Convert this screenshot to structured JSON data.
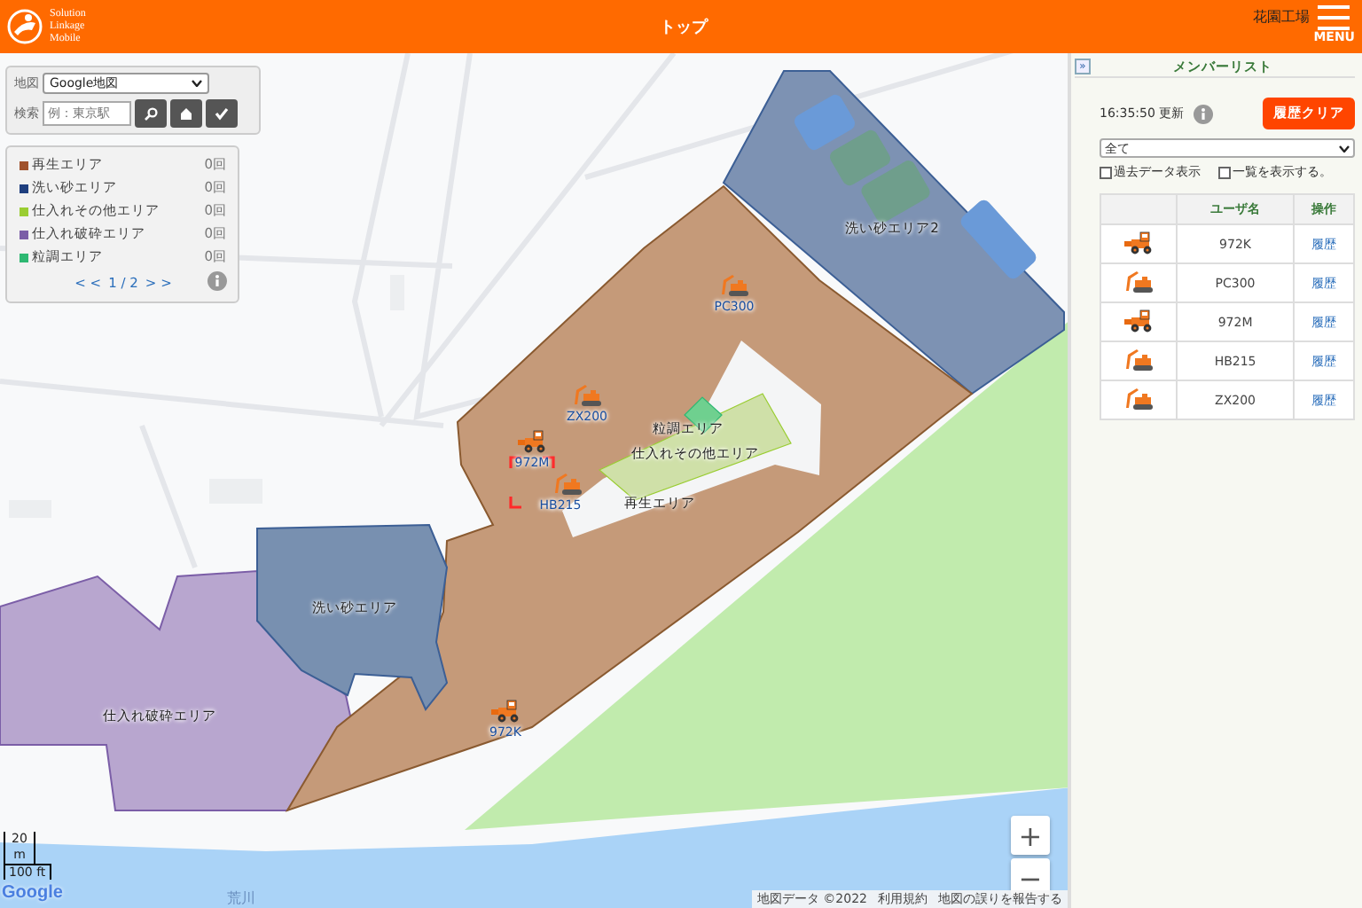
{
  "header": {
    "logo_lines": [
      "Solution",
      "Linkage",
      "Mobile"
    ],
    "title": "トップ",
    "site": "花園工場",
    "menu_label": "MENU"
  },
  "map_controls": {
    "map_label": "地図",
    "map_type": "Google地図",
    "search_label": "検索",
    "search_placeholder": "例：東京駅"
  },
  "legend": {
    "items": [
      {
        "name": "再生エリア",
        "count": "0回",
        "color": "#a0522d"
      },
      {
        "name": "洗い砂エリア",
        "count": "0回",
        "color": "#1f3f7f"
      },
      {
        "name": "仕入れその他エリア",
        "count": "0回",
        "color": "#9acd32"
      },
      {
        "name": "仕入れ破砕エリア",
        "count": "0回",
        "color": "#7b5ea7"
      },
      {
        "name": "粒調エリア",
        "count": "0回",
        "color": "#2eb872"
      }
    ],
    "pager_prev": "< <",
    "page": "1 / 2",
    "pager_next": "> >"
  },
  "map": {
    "areas": [
      {
        "label": "洗い砂エリア2"
      },
      {
        "label": "粒調エリア"
      },
      {
        "label": "仕入れその他エリア"
      },
      {
        "label": "再生エリア"
      },
      {
        "label": "洗い砂エリア"
      },
      {
        "label": "仕入れ破砕エリア"
      }
    ],
    "vehicles": [
      {
        "kind": "excavator",
        "label": "PC300",
        "selected": false
      },
      {
        "kind": "excavator",
        "label": "ZX200",
        "selected": false
      },
      {
        "kind": "loader",
        "label": "972M",
        "selected": true
      },
      {
        "kind": "excavator",
        "label": "HB215",
        "selected": false
      },
      {
        "kind": "loader",
        "label": "972K",
        "selected": false
      }
    ],
    "river_label": "荒川",
    "zoom_in": "+",
    "zoom_out": "−",
    "scale_metric": "20 m",
    "scale_imperial": "100 ft",
    "logo": "Google",
    "attribution": [
      "地図データ ©2022",
      "利用規約",
      "地図の誤りを報告する"
    ]
  },
  "member_list": {
    "collapse": "»",
    "title": "メンバーリスト",
    "updated": "16:35:50 更新",
    "clear_button": "履歴クリア",
    "filter": "全て",
    "options": [
      {
        "label": "過去データ表示",
        "checked": false
      },
      {
        "label": "一覧を表示する。",
        "checked": false
      }
    ],
    "columns": [
      "ユーザ名",
      "操作"
    ],
    "rows": [
      {
        "kind": "loader",
        "name": "972K",
        "action": "履歴"
      },
      {
        "kind": "excavator",
        "name": "PC300",
        "action": "履歴"
      },
      {
        "kind": "loader",
        "name": "972M",
        "action": "履歴"
      },
      {
        "kind": "excavator",
        "name": "HB215",
        "action": "履歴"
      },
      {
        "kind": "excavator",
        "name": "ZX200",
        "action": "履歴"
      }
    ]
  }
}
